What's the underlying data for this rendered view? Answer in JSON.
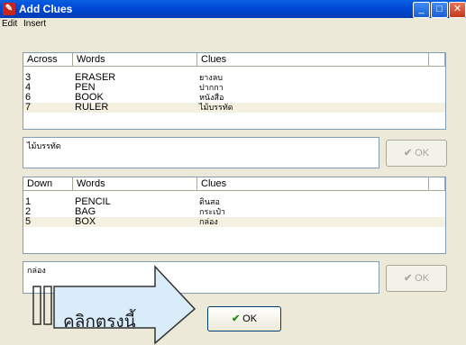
{
  "window": {
    "title": "Add Clues"
  },
  "menu": {
    "edit": "Edit",
    "insert": "Insert"
  },
  "across": {
    "headers": [
      "Across",
      "Words",
      "Clues"
    ],
    "rows": [
      {
        "num": "3",
        "word": "ERASER",
        "clue": "ยางลบ"
      },
      {
        "num": "4",
        "word": "PEN",
        "clue": "ปากกา"
      },
      {
        "num": "6",
        "word": "BOOK",
        "clue": "หนังสือ"
      },
      {
        "num": "7",
        "word": "RULER",
        "clue": "ไม้บรรทัด"
      }
    ],
    "edit_value": "ไม้บรรทัด",
    "ok_label": "OK"
  },
  "down": {
    "headers": [
      "Down",
      "Words",
      "Clues"
    ],
    "rows": [
      {
        "num": "1",
        "word": "PENCIL",
        "clue": "ดินสอ"
      },
      {
        "num": "2",
        "word": "BAG",
        "clue": "กระเป๋า"
      },
      {
        "num": "5",
        "word": "BOX",
        "clue": "กล่อง"
      }
    ],
    "edit_value": "กล่อง",
    "ok_label": "OK"
  },
  "main_ok_label": "OK",
  "callout": {
    "text": "คลิกตรงนี้"
  }
}
